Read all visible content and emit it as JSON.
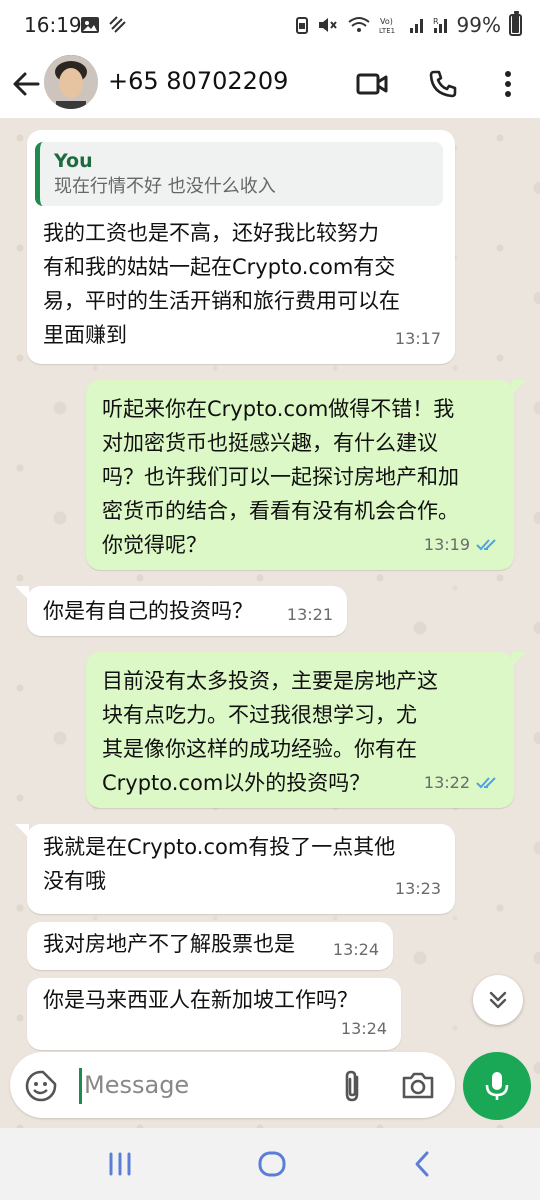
{
  "status_bar": {
    "time": "16:19",
    "battery_percent": "99%",
    "battery_level": 0.99
  },
  "header": {
    "contact_name": "+65 80702209",
    "icons": [
      "back-arrow-icon",
      "video-call-icon",
      "phone-call-icon",
      "more-options-icon"
    ]
  },
  "messages": [
    {
      "direction": "incoming",
      "quote_author": "You",
      "quote_text": "现在行情不好 也没什么收入",
      "lines": [
        "我的工资也是不高，还好我比较努力",
        "有和我的姑姑一起在Crypto.com有交",
        "易，平时的生活开销和旅行费用可以在",
        "里面赚到"
      ],
      "time": "13:17"
    },
    {
      "direction": "outgoing",
      "lines": [
        "听起来你在Crypto.com做得不错！我",
        "对加密货币也挺感兴趣，有什么建议",
        "吗？也许我们可以一起探讨房地产和加",
        "密货币的结合，看看有没有机会合作。",
        "你觉得呢？"
      ],
      "time": "13:19",
      "status": "read"
    },
    {
      "direction": "incoming",
      "lines": [
        "你是有自己的投资吗？"
      ],
      "time": "13:21"
    },
    {
      "direction": "outgoing",
      "lines": [
        "目前没有太多投资，主要是房地产这",
        "块有点吃力。不过我很想学习，尤",
        "其是像你这样的成功经验。你有在",
        "Crypto.com以外的投资吗？"
      ],
      "time": "13:22",
      "status": "read"
    },
    {
      "direction": "incoming",
      "lines": [
        "我就是在Crypto.com有投了一点其他",
        "没有哦"
      ],
      "time": "13:23"
    },
    {
      "direction": "incoming",
      "lines": [
        "我对房地产不了解股票也是"
      ],
      "time": "13:24"
    },
    {
      "direction": "incoming",
      "lines": [
        "你是马来西亚人在新加坡工作吗？"
      ],
      "time": "13:24"
    }
  ],
  "composer": {
    "placeholder": "Message"
  },
  "colors": {
    "outgoing_bubble": "#dcf8c6",
    "incoming_bubble": "#ffffff",
    "accent_green": "#1aa856",
    "read_ticks": "#4fa3e0",
    "chat_background": "#ece5dd"
  }
}
